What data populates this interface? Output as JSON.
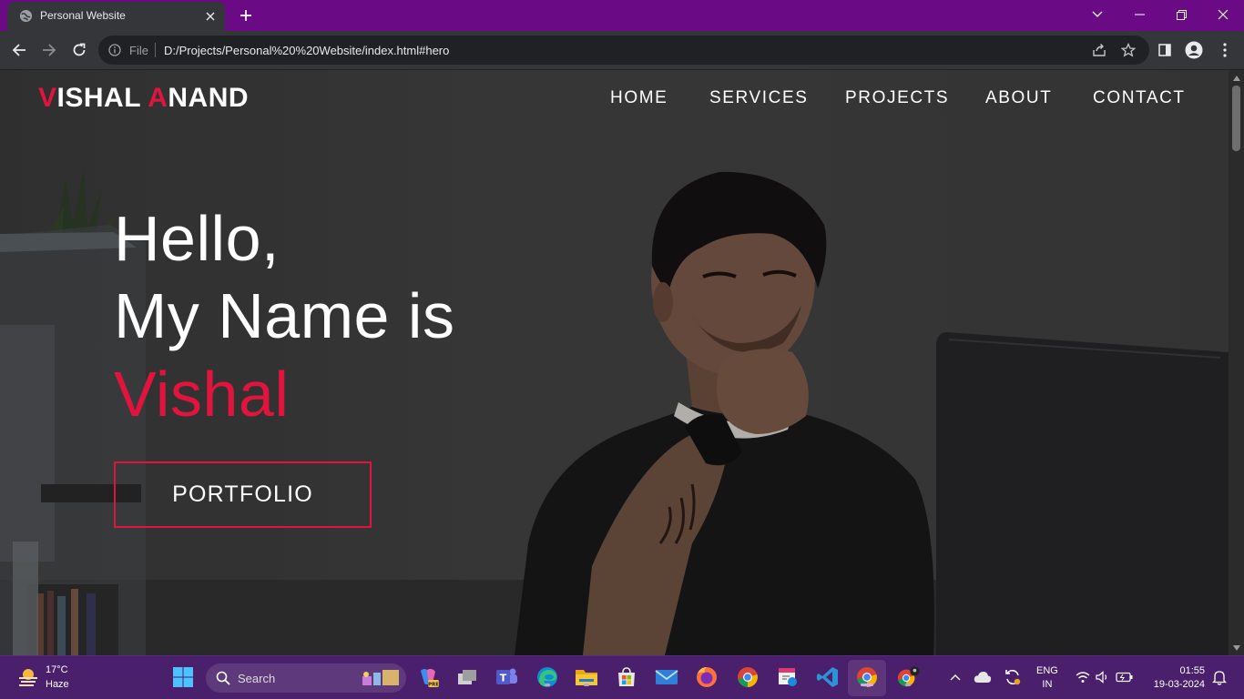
{
  "browser": {
    "tab_title": "Personal Website",
    "omnibox_scheme": "File",
    "url": "D:/Projects/Personal%20%20Website/index.html#hero"
  },
  "site": {
    "logo_first_initial": "V",
    "logo_first_rest": "ISHAL ",
    "logo_last_initial": "A",
    "logo_last_rest": "NAND",
    "nav": [
      "HOME",
      "SERVICES",
      "PROJECTS",
      "ABOUT",
      "CONTACT"
    ],
    "hero": {
      "line1": "Hello,",
      "line2": "My Name is",
      "name": "Vishal",
      "button": "PORTFOLIO"
    },
    "accent_color": "#e0143c"
  },
  "taskbar": {
    "weather_temp": "17°C",
    "weather_desc": "Haze",
    "search_label": "Search",
    "lang_line1": "ENG",
    "lang_line2": "IN",
    "time": "01:55",
    "date": "19-03-2024"
  }
}
